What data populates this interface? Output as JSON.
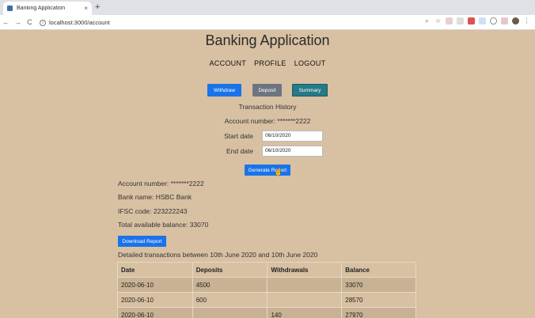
{
  "browser": {
    "tab_title": "Banking Application",
    "tab_close": "×",
    "new_tab": "+",
    "back": "←",
    "forward": "→",
    "reload": "C",
    "url": "localhost:3000/account"
  },
  "app": {
    "title": "Banking Application",
    "nav": [
      "ACCOUNT",
      "PROFILE",
      "LOGOUT"
    ]
  },
  "actions": {
    "withdraw": "Withdraw",
    "deposit": "Deposit",
    "summary": "Summary"
  },
  "summary": {
    "section_title": "Transaction History",
    "account_label": "Account number:",
    "account_value": "*******2222",
    "start_label": "Start date",
    "start_value": "06/10/2020",
    "end_label": "End date",
    "end_value": "06/10/2020",
    "generate_label": "Generate Report"
  },
  "report": {
    "account": "Account number: *******2222",
    "bank": "Bank name: HSBC Bank",
    "ifsc": "IFSC code: 223222243",
    "balance": "Total available balance: 33070",
    "download_label": "Download Report",
    "detail_title": "Detailed transactions between 10th June 2020 and 10th June 2020",
    "columns": [
      "Date",
      "Deposits",
      "Withdrawals",
      "Balance"
    ],
    "rows": [
      [
        "2020-06-10",
        "4500",
        "",
        "33070"
      ],
      [
        "2020-06-10",
        "600",
        "",
        "28570"
      ],
      [
        "2020-06-10",
        "",
        "140",
        "27970"
      ]
    ]
  },
  "colors": {
    "background": "#d8c0a2",
    "primary": "#1a73e8",
    "secondary": "#6c757d",
    "summary": "#257a86"
  }
}
